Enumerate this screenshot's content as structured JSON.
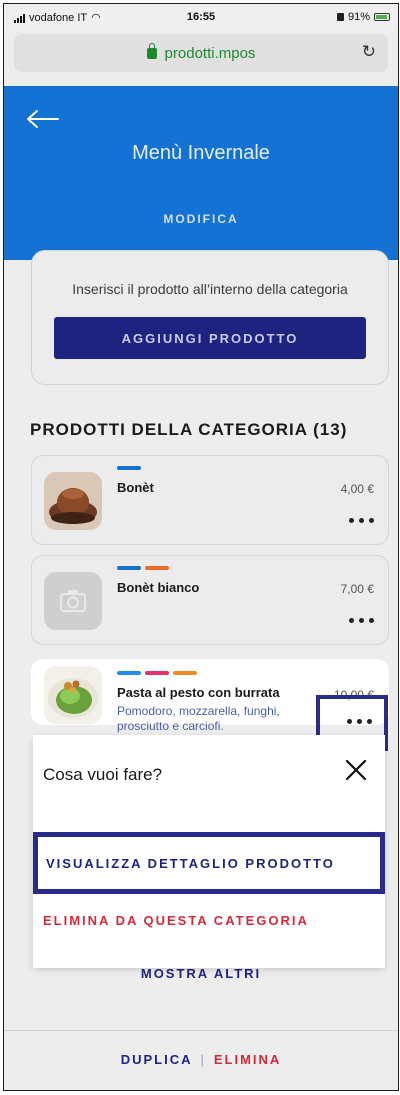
{
  "status_bar": {
    "carrier": "vodafone IT",
    "time": "16:55",
    "battery": "91%"
  },
  "browser": {
    "url": "prodotti.mpos"
  },
  "header": {
    "title": "Menù Invernale",
    "edit_label": "MODIFICA"
  },
  "add_card": {
    "text": "Inserisci il prodotto all’interno della categoria",
    "button_label": "AGGIUNGI PRODOTTO"
  },
  "section": {
    "title": "PRODOTTI DELLA CATEGORIA (13)"
  },
  "products": [
    {
      "name": "Bonèt",
      "price": "4,00 €",
      "tags": [
        "#1372d3"
      ]
    },
    {
      "name": "Bonèt bianco",
      "price": "7,00 €",
      "tags": [
        "#1372d3",
        "#e8692a"
      ]
    },
    {
      "name": "Pasta al pesto con burrata",
      "price": "10,00 €",
      "description": "Pomodoro, mozzarella, funghi, prosciutto e carciofi.",
      "tags": [
        "#1e8ef0",
        "#e8306a",
        "#f08a2a"
      ]
    }
  ],
  "sheet": {
    "title": "Cosa vuoi fare?",
    "option_view": "VISUALIZZA DETTAGLIO PRODOTTO",
    "option_remove": "ELIMINA DA QUESTA CATEGORIA"
  },
  "list": {
    "show_more": "MOSTRA ALTRI"
  },
  "footer": {
    "duplicate": "DUPLICA",
    "separator": "|",
    "delete": "ELIMINA"
  },
  "colors": {
    "primary_blue": "#1372d3",
    "dark_navy": "#1f2380",
    "danger_red": "#d42a3b"
  }
}
